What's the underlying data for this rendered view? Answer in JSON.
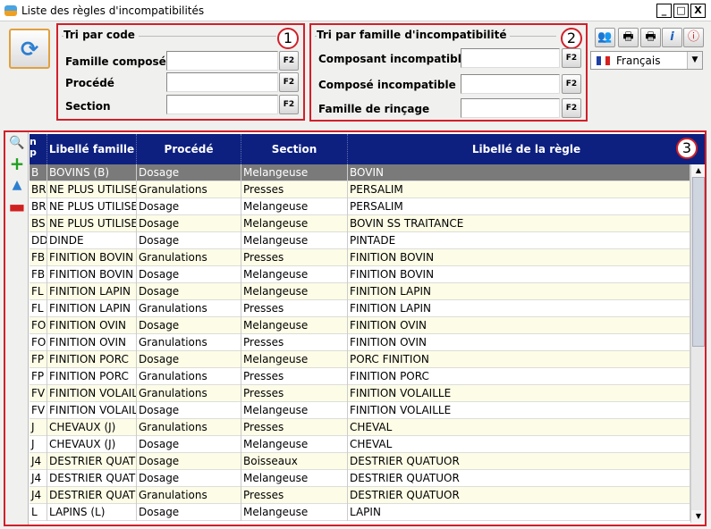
{
  "window": {
    "title": "Liste des règles d'incompatibilités",
    "minimize": "_",
    "maximize": "□",
    "close": "X"
  },
  "panel1": {
    "title": "Tri par code",
    "badge": "1",
    "fields": [
      {
        "label": "Famille composé",
        "f2": "F2"
      },
      {
        "label": "Procédé",
        "f2": "F2"
      },
      {
        "label": "Section",
        "f2": "F2"
      }
    ]
  },
  "panel2": {
    "title": "Tri par famille d'incompatibilité",
    "badge": "2",
    "fields": [
      {
        "label": "Composant incompatible",
        "f2": "F2"
      },
      {
        "label": "Composé incompatible",
        "f2": "F2"
      },
      {
        "label": "Famille de rinçage",
        "f2": "F2"
      }
    ]
  },
  "language": "Français",
  "grid": {
    "badge": "3",
    "headers": [
      "n\np",
      "Libellé famille",
      "Procédé",
      "Section",
      "Libellé de la règle"
    ],
    "rows": [
      [
        "B",
        "BOVINS (B)",
        "Dosage",
        "Melangeuse",
        "BOVIN"
      ],
      [
        "BR",
        "NE PLUS UTILISE",
        "Granulations",
        "Presses",
        "PERSALIM"
      ],
      [
        "BR",
        "NE PLUS UTILISE",
        "Dosage",
        "Melangeuse",
        "PERSALIM"
      ],
      [
        "BS",
        "NE PLUS UTILISE",
        "Dosage",
        "Melangeuse",
        "BOVIN SS TRAITANCE"
      ],
      [
        "DD",
        "DINDE",
        "Dosage",
        "Melangeuse",
        "PINTADE"
      ],
      [
        "FB",
        "FINITION BOVIN",
        "Granulations",
        "Presses",
        "FINITION BOVIN"
      ],
      [
        "FB",
        "FINITION BOVIN",
        "Dosage",
        "Melangeuse",
        "FINITION BOVIN"
      ],
      [
        "FL",
        "FINITION LAPIN",
        "Dosage",
        "Melangeuse",
        "FINITION LAPIN"
      ],
      [
        "FL",
        "FINITION LAPIN",
        "Granulations",
        "Presses",
        "FINITION LAPIN"
      ],
      [
        "FO",
        "FINITION OVIN",
        "Dosage",
        "Melangeuse",
        "FINITION OVIN"
      ],
      [
        "FO",
        "FINITION OVIN",
        "Granulations",
        "Presses",
        "FINITION OVIN"
      ],
      [
        "FP",
        "FINITION PORC",
        "Dosage",
        "Melangeuse",
        "PORC FINITION"
      ],
      [
        "FP",
        "FINITION PORC",
        "Granulations",
        "Presses",
        "FINITION PORC"
      ],
      [
        "FV",
        "FINITION VOLAIL",
        "Granulations",
        "Presses",
        "FINITION VOLAILLE"
      ],
      [
        "FV",
        "FINITION VOLAIL",
        "Dosage",
        "Melangeuse",
        "FINITION VOLAILLE"
      ],
      [
        "J",
        "CHEVAUX (J)",
        "Granulations",
        "Presses",
        "CHEVAL"
      ],
      [
        "J",
        "CHEVAUX (J)",
        "Dosage",
        "Melangeuse",
        "CHEVAL"
      ],
      [
        "J4",
        "DESTRIER QUATU",
        "Dosage",
        "Boisseaux",
        "DESTRIER QUATUOR"
      ],
      [
        "J4",
        "DESTRIER QUATU",
        "Dosage",
        "Melangeuse",
        "DESTRIER QUATUOR"
      ],
      [
        "J4",
        "DESTRIER QUATU",
        "Granulations",
        "Presses",
        "DESTRIER QUATUOR"
      ],
      [
        "L",
        "LAPINS (L)",
        "Dosage",
        "Melangeuse",
        "LAPIN"
      ]
    ]
  },
  "colors": {
    "header_bg": "#0d2080",
    "selected_row": "#7a7a7a",
    "alt_row": "#fdfce6",
    "highlight": "#d0202a"
  }
}
